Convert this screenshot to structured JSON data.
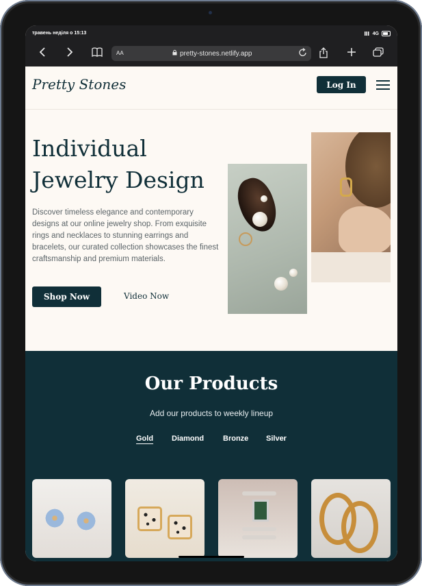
{
  "status": {
    "left": "травень неділя о 15:13",
    "network": "4G"
  },
  "browser": {
    "back_icon": "chevron-left-icon",
    "forward_icon": "chevron-right-icon",
    "reader_icon": "book-icon",
    "text_size": "AA",
    "url": "pretty-stones.netlify.app",
    "reload_icon": "reload-icon",
    "share_icon": "share-icon",
    "add_icon": "plus-icon",
    "tabs_icon": "tabs-icon"
  },
  "header": {
    "logo": "Pretty Stones",
    "login": "Log In",
    "menu_icon": "hamburger-menu-icon"
  },
  "hero": {
    "title": "Individual Jewelry Design",
    "text": "Discover timeless elegance and contemporary designs at our online jewelry shop. From exquisite rings and necklaces to stunning earrings and bracelets, our curated collection showcases the finest craftsmanship and premium materials.",
    "shop_button": "Shop Now",
    "video_link": "Video Now"
  },
  "products": {
    "title": "Our Products",
    "subtitle": "Add our products to weekly lineup",
    "tabs": [
      "Gold",
      "Diamond",
      "Bronze",
      "Silver"
    ],
    "active_tab": "Gold"
  },
  "colors": {
    "brand_dark": "#102f38",
    "page_bg": "#fdf9f4"
  }
}
